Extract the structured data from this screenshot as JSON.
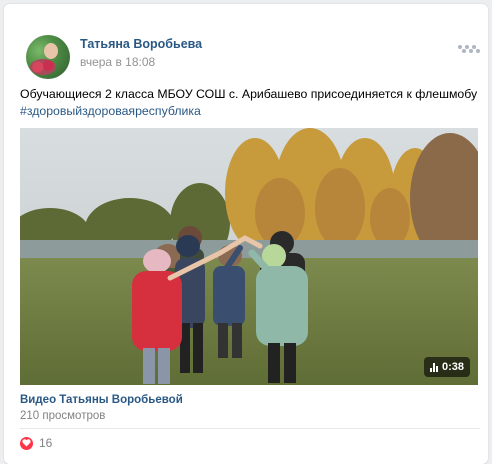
{
  "post": {
    "author": "Татьяна Воробьева",
    "time": "вчера в 18:08",
    "text": "Обучающиеся 2 класса МБОУ СОШ с. Арибашево присоединяется к флешмобу",
    "hashtag": "#здоровыйздороваяреспублика"
  },
  "video": {
    "duration": "0:38",
    "title": "Видео Татьяны Воробьевой",
    "views": "210 просмотров"
  },
  "reactions": {
    "likes": "16"
  },
  "colors": {
    "link": "#2a5885",
    "meta": "#939393",
    "like": "#ff3347",
    "page_background": "#edeef0"
  },
  "icons": [
    "more-options-icon",
    "video-bars-icon",
    "heart-icon"
  ]
}
